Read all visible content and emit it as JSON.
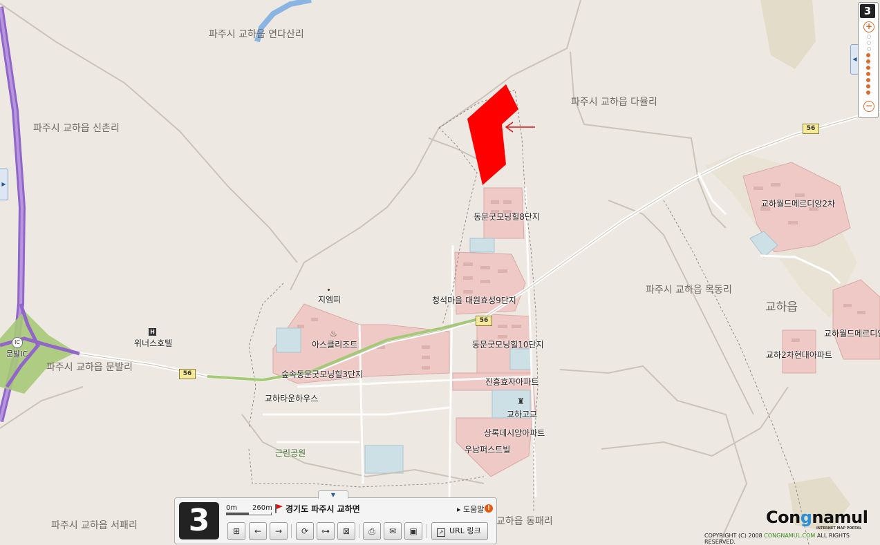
{
  "map": {
    "region_labels": [
      "파주시 교하읍 연다산리",
      "파주시 교하읍 신촌리",
      "파주시 교하읍 다율리",
      "파주시 교하읍 목동리",
      "파주시 교하읍 문발리",
      "파주시 교하읍 서패리",
      "교하읍 동패리"
    ],
    "town_label": "교하읍",
    "places": [
      "동문굿모닝힐8단지",
      "교하월드메르디앙2차",
      "지엠피",
      "청석마을 대원효성9단지",
      "아스클리조트",
      "위너스호텔",
      "동문굿모닝힐10단지",
      "교하월드메르디앙",
      "교하2차현대아파트",
      "숲속동문굿모닝힐3단지",
      "진흥효자아파트",
      "교하타운하우스",
      "교하고교",
      "상록데시앙아파트",
      "우남퍼스트빌",
      "근린공원"
    ],
    "interchange": [
      "IC",
      "문발IC"
    ],
    "route_number": "56",
    "highlight_color": "#ff0000",
    "arrow_color": "#e01010"
  },
  "zoom_control": {
    "level": "3",
    "zoom_in_icon": "plus-icon",
    "zoom_out_icon": "minus-icon",
    "zoom_in": "+",
    "zoom_out": "−",
    "active_color": "#e06a2a"
  },
  "toolbar": {
    "level": "3",
    "scale_start": "0m",
    "scale_distance": "260m",
    "address": "경기도 파주시 교하면",
    "help_label": "도움말",
    "help_badge": "!",
    "url_label": "URL 링크",
    "buttons": [
      {
        "name": "area-zoom-icon",
        "glyph": "⊞"
      },
      {
        "name": "back-arrow-icon",
        "glyph": "←"
      },
      {
        "name": "forward-arrow-icon",
        "glyph": "→"
      },
      {
        "name": "refresh-icon",
        "glyph": "⟳"
      },
      {
        "name": "distance-icon",
        "glyph": "⊶"
      },
      {
        "name": "area-measure-icon",
        "glyph": "⊠"
      },
      {
        "name": "print-icon",
        "glyph": "⎙"
      },
      {
        "name": "mail-icon",
        "glyph": "✉"
      },
      {
        "name": "save-icon",
        "glyph": "▣"
      }
    ]
  },
  "branding": {
    "logo_left": "Con",
    "logo_o": "g",
    "logo_right": "namul",
    "tagline": "INTERNET MAP PORTAL",
    "copyright_pre": "COPYRIGHT (C) 2008",
    "copyright_site": "CONGNAMUL.COM",
    "copyright_post": "ALL RIGHTS RESERVED."
  }
}
